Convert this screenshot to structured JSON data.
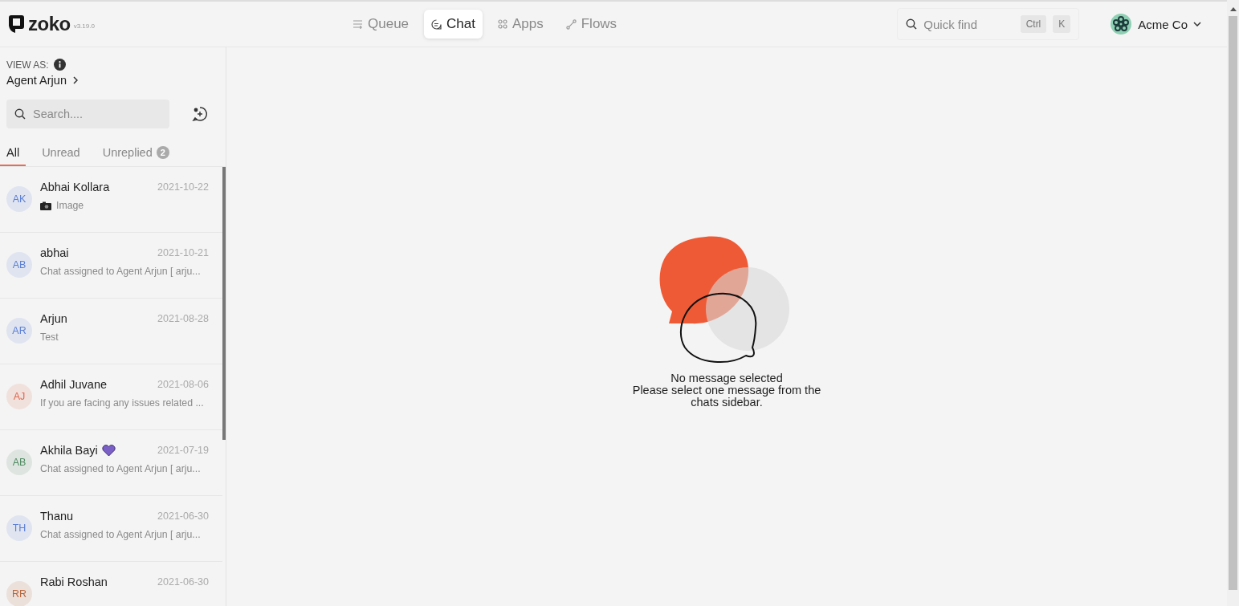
{
  "header": {
    "logo": "zoko",
    "version": "v3.19.0",
    "nav": [
      {
        "label": "Queue",
        "selected": false
      },
      {
        "label": "Chat",
        "selected": true
      },
      {
        "label": "Apps",
        "selected": false
      },
      {
        "label": "Flows",
        "selected": false
      }
    ],
    "quick_find": {
      "placeholder": "Quick find",
      "keys": [
        "Ctrl",
        "K"
      ]
    },
    "account": {
      "name": "Acme Co"
    }
  },
  "sidebar": {
    "view_as_label": "VIEW AS:",
    "view_as_value": "Agent Arjun",
    "search": {
      "placeholder": "Search...."
    },
    "tabs": [
      {
        "label": "All",
        "selected": true
      },
      {
        "label": "Unread",
        "selected": false
      },
      {
        "label": "Unreplied",
        "badge": "2",
        "selected": false
      }
    ],
    "chats": [
      {
        "initials": "AK",
        "color": "#5b7fd6",
        "name": "Abhai Kollara",
        "date": "2021-10-22",
        "preview": "Image",
        "kind": "image"
      },
      {
        "initials": "AB",
        "color": "#5b7fd6",
        "name": "abhai",
        "date": "2021-10-21",
        "preview": "Chat assigned to Agent Arjun [ arju...",
        "kind": "text"
      },
      {
        "initials": "AR",
        "color": "#5b7fd6",
        "name": "Arjun",
        "date": "2021-08-28",
        "preview": "Test",
        "kind": "text"
      },
      {
        "initials": "AJ",
        "color": "#e0674a",
        "name": "Adhil Juvane",
        "date": "2021-08-06",
        "preview": "If you are facing any issues related ...",
        "kind": "text"
      },
      {
        "initials": "AB",
        "color": "#4f8a62",
        "name": "Akhila Bayi",
        "heart": true,
        "date": "2021-07-19",
        "preview": "Chat assigned to Agent Arjun [ arju...",
        "kind": "text"
      },
      {
        "initials": "TH",
        "color": "#5b7fd6",
        "name": "Thanu",
        "date": "2021-06-30",
        "preview": "Chat assigned to Agent Arjun [ arju...",
        "kind": "text"
      },
      {
        "initials": "RR",
        "color": "#b8643a",
        "name": "Rabi Roshan",
        "date": "2021-06-30"
      }
    ]
  },
  "empty_state": {
    "title": "No message selected",
    "message": "Please select one message from the chats sidebar."
  }
}
